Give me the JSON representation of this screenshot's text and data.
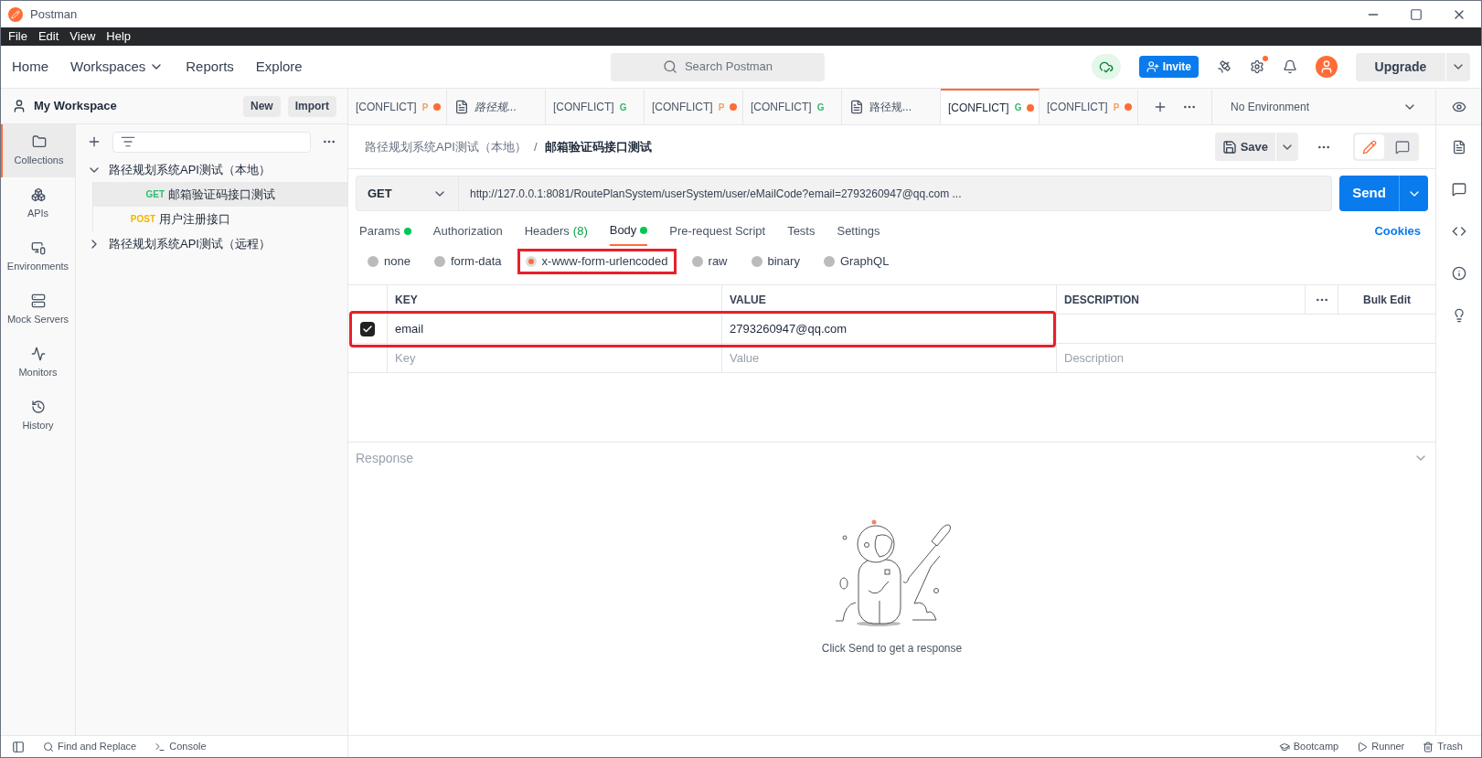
{
  "window": {
    "title": "Postman"
  },
  "menu": [
    "File",
    "Edit",
    "View",
    "Help"
  ],
  "nav": {
    "items": [
      {
        "label": "Home",
        "dropdown": false
      },
      {
        "label": "Workspaces",
        "dropdown": true
      },
      {
        "label": "Reports",
        "dropdown": false
      },
      {
        "label": "Explore",
        "dropdown": false
      }
    ],
    "search": {
      "placeholder": "Search Postman"
    },
    "invite": "Invite",
    "upgrade": "Upgrade"
  },
  "workspace": {
    "name": "My Workspace",
    "buttons": [
      "New",
      "Import"
    ]
  },
  "tabs": [
    {
      "kind": "request",
      "label": "[CONFLICT]",
      "method": "P",
      "color": "#f0a060",
      "unsaved": true,
      "preview": false,
      "selected": false
    },
    {
      "kind": "document",
      "label": "路径规...",
      "preview": true,
      "unsaved": false,
      "selected": false
    },
    {
      "kind": "request",
      "label": "[CONFLICT]",
      "method": "G",
      "color": "#2ebd6b",
      "unsaved": false,
      "preview": false,
      "selected": false
    },
    {
      "kind": "request",
      "label": "[CONFLICT]",
      "method": "P",
      "color": "#f0a060",
      "unsaved": true,
      "preview": false,
      "selected": false
    },
    {
      "kind": "request",
      "label": "[CONFLICT]",
      "method": "G",
      "color": "#2ebd6b",
      "unsaved": false,
      "preview": false,
      "selected": false
    },
    {
      "kind": "document",
      "label": "路径规...",
      "preview": false,
      "unsaved": false,
      "selected": false
    },
    {
      "kind": "request",
      "label": "[CONFLICT]",
      "method": "G",
      "color": "#2ebd6b",
      "unsaved": true,
      "preview": false,
      "selected": true
    },
    {
      "kind": "request",
      "label": "[CONFLICT]",
      "method": "P",
      "color": "#f0a060",
      "unsaved": true,
      "preview": false,
      "selected": false
    }
  ],
  "environment": "No Environment",
  "sidebar": {
    "items": [
      {
        "label": "Collections",
        "kind": "collections",
        "selected": true
      },
      {
        "label": "APIs",
        "kind": "apis",
        "selected": false
      },
      {
        "label": "Environments",
        "kind": "environments",
        "selected": false
      },
      {
        "label": "Mock Servers",
        "kind": "mock",
        "selected": false
      },
      {
        "label": "Monitors",
        "kind": "monitors",
        "selected": false
      },
      {
        "label": "History",
        "kind": "history",
        "selected": false
      }
    ]
  },
  "tree": [
    {
      "kind": "folder",
      "label": "路径规划系统API测试（本地）",
      "expanded": true,
      "selected": false,
      "children": [
        {
          "kind": "request",
          "method": "GET",
          "color": "#2ebd6b",
          "label": "邮箱验证码接口测试",
          "selected": true
        },
        {
          "kind": "request",
          "method": "POST",
          "color": "#f5b400",
          "label": "用户注册接口",
          "selected": false
        }
      ]
    },
    {
      "kind": "folder",
      "label": "路径规划系统API测试（远程）",
      "expanded": false,
      "selected": false
    }
  ],
  "breadcrumb": {
    "parent": "路径规划系统API测试（本地）",
    "separator": "/",
    "current": "邮箱验证码接口测试"
  },
  "save": "Save",
  "modes": [
    {
      "kind": "edit",
      "selected": true
    },
    {
      "kind": "comment",
      "selected": false
    }
  ],
  "request": {
    "method": "GET",
    "url": "http://127.0.0.1:8081/RoutePlanSystem/userSystem/user/eMailCode?email=2793260947@qq.com ...",
    "send": "Send"
  },
  "request_tabs": [
    {
      "label": "Params",
      "dot": true,
      "selected": false
    },
    {
      "label": "Authorization",
      "dot": false,
      "selected": false
    },
    {
      "label": "Headers",
      "count": "(8)",
      "dot": false,
      "selected": false
    },
    {
      "label": "Body",
      "dot": true,
      "selected": true
    },
    {
      "label": "Pre-request Script",
      "dot": false,
      "selected": false
    },
    {
      "label": "Tests",
      "dot": false,
      "selected": false
    },
    {
      "label": "Settings",
      "dot": false,
      "selected": false
    }
  ],
  "cookies": "Cookies",
  "body_types": [
    {
      "label": "none",
      "selected": false,
      "annotated": false
    },
    {
      "label": "form-data",
      "selected": false,
      "annotated": false
    },
    {
      "label": "x-www-form-urlencoded",
      "selected": true,
      "annotated": true
    },
    {
      "label": "raw",
      "selected": false,
      "annotated": false
    },
    {
      "label": "binary",
      "selected": false,
      "annotated": false
    },
    {
      "label": "GraphQL",
      "selected": false,
      "annotated": false
    }
  ],
  "params": {
    "columns": [
      "KEY",
      "VALUE",
      "DESCRIPTION"
    ],
    "bulk_edit": "Bulk Edit",
    "rows": [
      {
        "checked": true,
        "key": "email",
        "value": "2793260947@qq.com",
        "annotated": true
      }
    ],
    "placeholders": {
      "key": "Key",
      "value": "Value",
      "description": "Description"
    }
  },
  "response": {
    "title": "Response",
    "hint": "Click Send to get a response"
  },
  "status_bar": {
    "left": [
      "Find and Replace",
      "Console"
    ],
    "right": [
      "Bootcamp",
      "Runner",
      "Trash"
    ]
  }
}
